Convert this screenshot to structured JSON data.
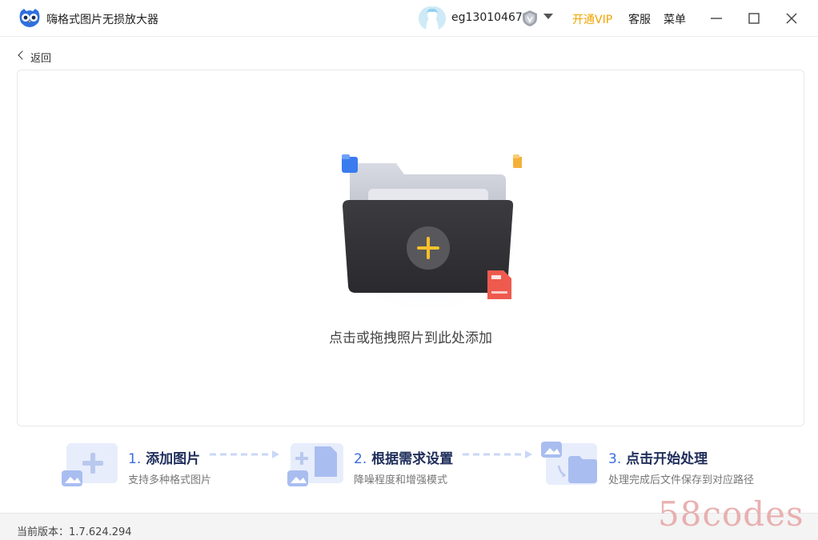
{
  "app": {
    "title": "嗨格式图片无损放大器"
  },
  "user": {
    "name": "eg13010467"
  },
  "header": {
    "vip_label": "开通VIP",
    "service_label": "客服",
    "menu_label": "菜单"
  },
  "nav": {
    "back_label": "返回"
  },
  "dropzone": {
    "hint": "点击或拖拽照片到此处添加"
  },
  "steps": [
    {
      "num": "1.",
      "title": "添加图片",
      "desc": "支持多种格式图片"
    },
    {
      "num": "2.",
      "title": "根据需求设置",
      "desc": "降噪程度和增强模式"
    },
    {
      "num": "3.",
      "title": "点击开始处理",
      "desc": "处理完成后文件保存到对应路径"
    }
  ],
  "footer": {
    "version_label": "当前版本：",
    "version_value": "1.7.624.294"
  },
  "watermark": "58codes",
  "colors": {
    "accent": "#3a6be0",
    "vip": "#f0a400",
    "step_title": "#1f2e5b"
  }
}
